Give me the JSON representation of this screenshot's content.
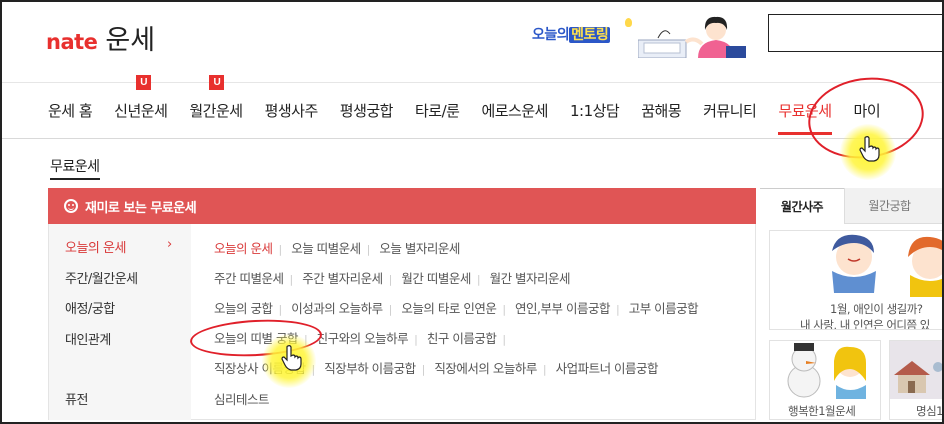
{
  "header": {
    "logo_brand": "nate",
    "logo_title": "운세",
    "banner_text_a": "오늘의",
    "banner_text_b": "멘토링"
  },
  "nav": {
    "items": [
      {
        "label": "운세 홈"
      },
      {
        "label": "신년운세",
        "badge": "U"
      },
      {
        "label": "월간운세",
        "badge": "U"
      },
      {
        "label": "평생사주"
      },
      {
        "label": "평생궁합"
      },
      {
        "label": "타로/룬"
      },
      {
        "label": "에로스운세"
      },
      {
        "label": "1:1상담"
      },
      {
        "label": "꿈해몽"
      },
      {
        "label": "커뮤니티"
      },
      {
        "label": "무료운세",
        "active": true
      },
      {
        "label": "마이"
      }
    ]
  },
  "breadcrumb": "무료운세",
  "panel": {
    "title": "재미로 보는 무료운세",
    "categories": [
      {
        "label": "오늘의 운세",
        "active": true
      },
      {
        "label": "주간/월간운세"
      },
      {
        "label": "애정/궁합"
      },
      {
        "label": "대인관계"
      },
      {
        "label": "퓨전"
      }
    ],
    "link_rows": [
      [
        "오늘의 운세",
        "오늘 띠별운세",
        "오늘 별자리운세"
      ],
      [
        "주간 띠별운세",
        "주간 별자리운세",
        "월간 띠별운세",
        "월간 별자리운세"
      ],
      [
        "오늘의 궁합",
        "이성과의 오늘하루",
        "오늘의 타로 인연운",
        "연인,부부 이름궁합",
        "고부 이름궁합"
      ],
      [
        "오늘의 띠별 궁합",
        "친구와의 오늘하루",
        "친구 이름궁합"
      ],
      [
        "직장상사 이름궁합",
        "직장부하 이름궁합",
        "직장에서의 오늘하루",
        "사업파트너 이름궁합"
      ],
      [
        "심리테스트"
      ]
    ]
  },
  "right": {
    "tabs": [
      {
        "label": "월간사주",
        "active": true
      },
      {
        "label": "월간궁합"
      }
    ],
    "card1_line1": "1월, 애인이 생길까?",
    "card1_line2": "내 사랑, 내 인연은 어디쯤 있",
    "card2_caption": "행복한1월운세",
    "card3_caption": "명심1"
  },
  "colors": {
    "brand_red": "#e8302e",
    "panel_head": "#e05555",
    "annotation_red": "#e0202a",
    "cursor_highlight": "#fff528"
  }
}
